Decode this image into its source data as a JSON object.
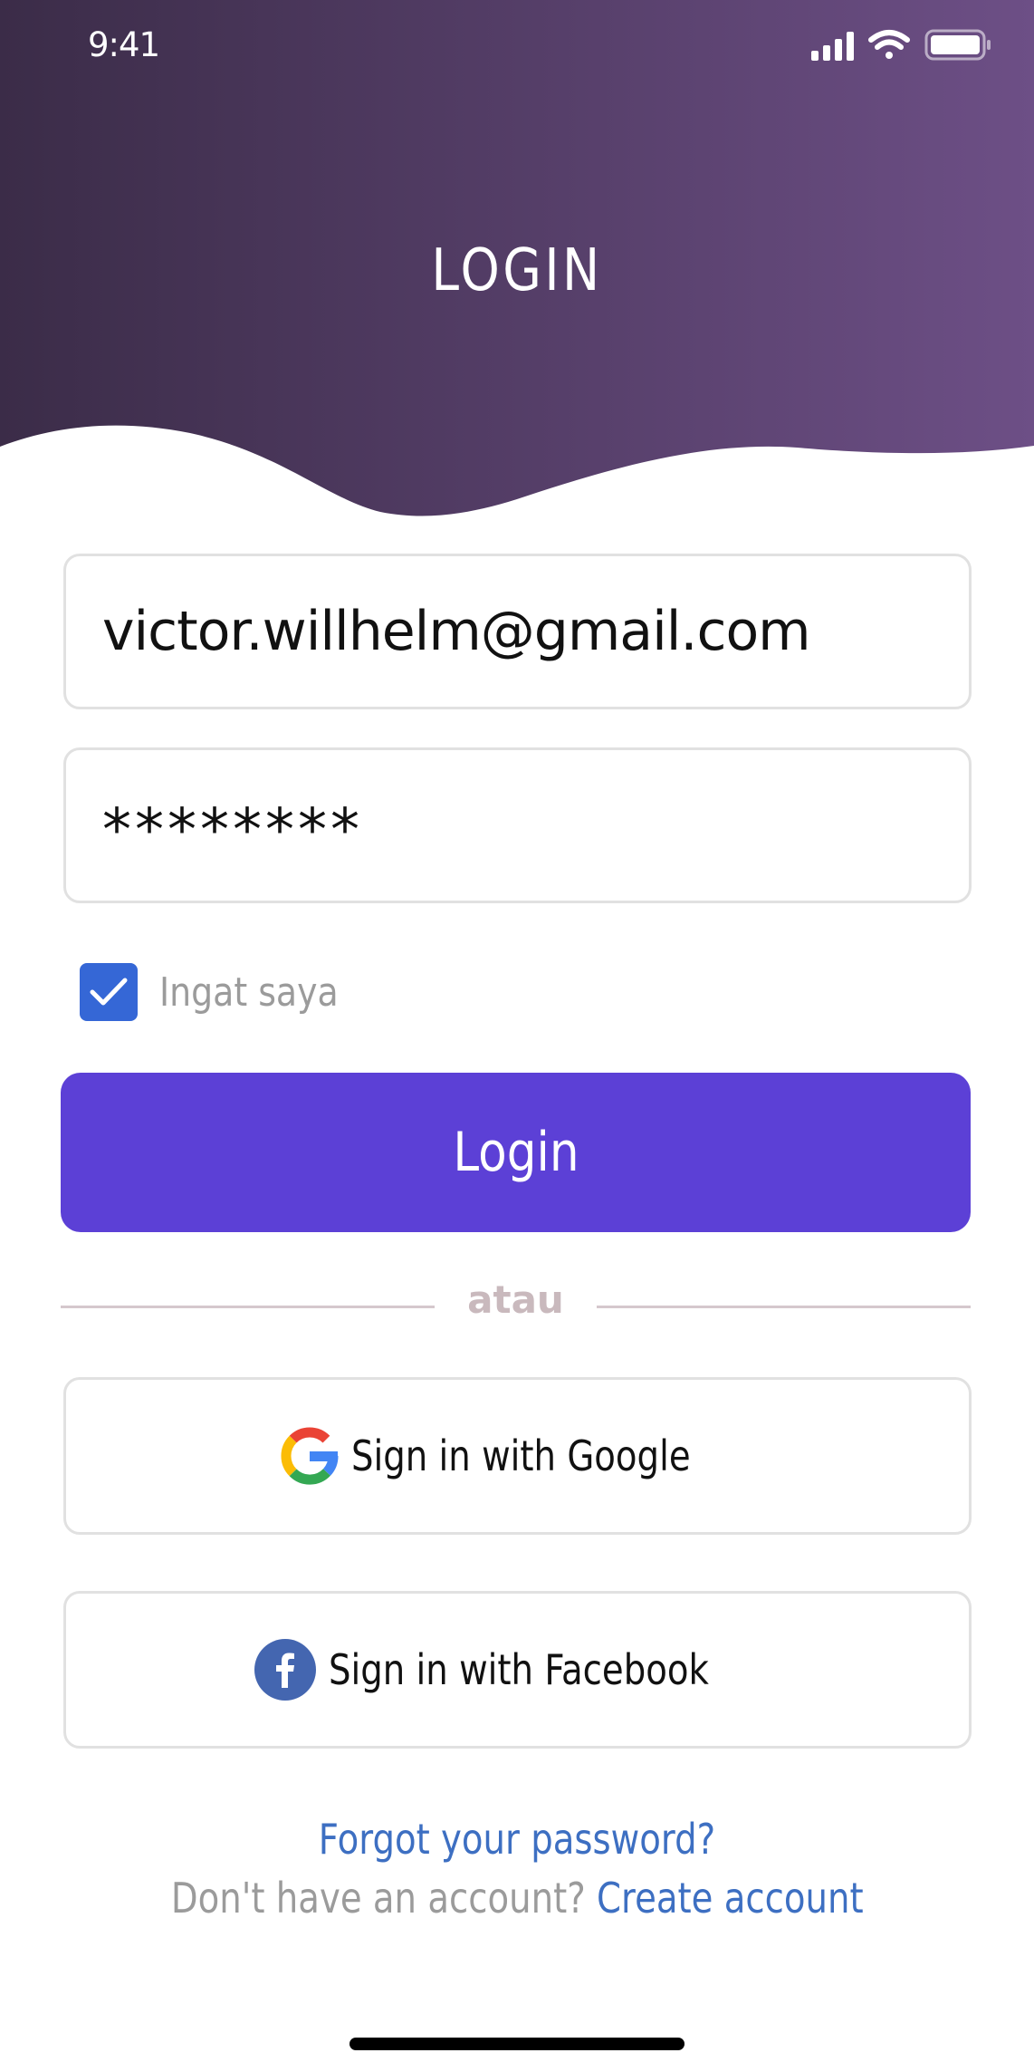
{
  "status_bar": {
    "time": "9:41",
    "icons": [
      "cellular-signal-icon",
      "wifi-icon",
      "battery-icon"
    ]
  },
  "header": {
    "title": "LOGIN",
    "gradient_start": "#3b2c48",
    "gradient_end": "#6d4f86"
  },
  "form": {
    "email_value": "victor.willhelm@gmail.com",
    "password_value": "********",
    "remember_label": "Ingat saya",
    "remember_checked": true,
    "login_label": "Login",
    "divider_label": "atau"
  },
  "social": {
    "google_label": "Sign in with Google",
    "facebook_label": "Sign in with Facebook"
  },
  "footer": {
    "forgot_label": "Forgot your password?",
    "signup_prompt": "Don't have an account?",
    "create_label": "Create account"
  },
  "colors": {
    "primary": "#5c40d6",
    "checkbox": "#3567d6",
    "link": "#3d6fc2",
    "facebook": "#4466b0"
  }
}
